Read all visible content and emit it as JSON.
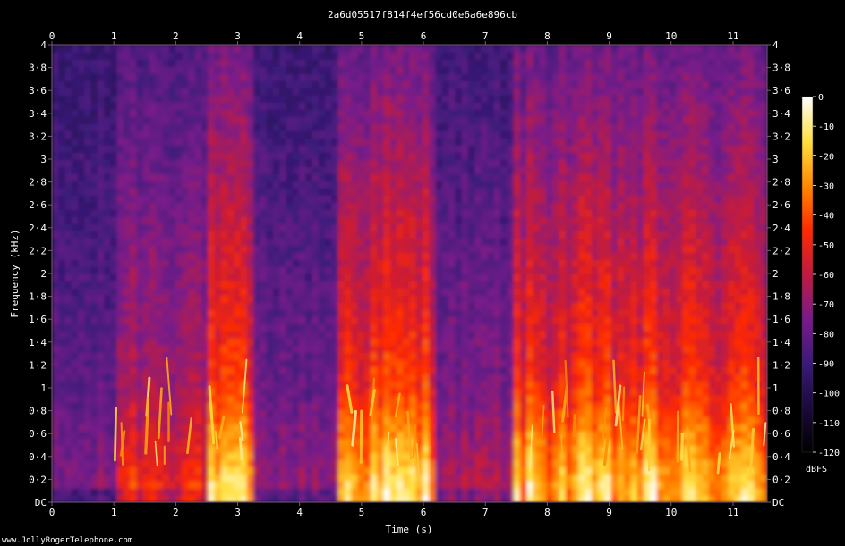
{
  "chart_data": {
    "type": "heatmap",
    "title": "2a6d05517f814f4ef56cd0e6a6e896cb",
    "xlabel": "Time (s)",
    "ylabel": "Frequency (kHz)",
    "xlim": [
      0,
      11.55
    ],
    "ylim": [
      0,
      4
    ],
    "x_ticks": [
      {
        "value": 0,
        "label": "0"
      },
      {
        "value": 1,
        "label": "1"
      },
      {
        "value": 2,
        "label": "2"
      },
      {
        "value": 3,
        "label": "3"
      },
      {
        "value": 4,
        "label": "4"
      },
      {
        "value": 5,
        "label": "5"
      },
      {
        "value": 6,
        "label": "6"
      },
      {
        "value": 7,
        "label": "7"
      },
      {
        "value": 8,
        "label": "8"
      },
      {
        "value": 9,
        "label": "9"
      },
      {
        "value": 10,
        "label": "10"
      },
      {
        "value": 11,
        "label": "11"
      }
    ],
    "y_ticks": [
      {
        "value": 0,
        "label": "DC"
      },
      {
        "value": 0.2,
        "label": "0·2"
      },
      {
        "value": 0.4,
        "label": "0·4"
      },
      {
        "value": 0.6,
        "label": "0·6"
      },
      {
        "value": 0.8,
        "label": "0·8"
      },
      {
        "value": 1.0,
        "label": "1"
      },
      {
        "value": 1.2,
        "label": "1·2"
      },
      {
        "value": 1.4,
        "label": "1·4"
      },
      {
        "value": 1.6,
        "label": "1·6"
      },
      {
        "value": 1.8,
        "label": "1·8"
      },
      {
        "value": 2.0,
        "label": "2"
      },
      {
        "value": 2.2,
        "label": "2·2"
      },
      {
        "value": 2.4,
        "label": "2·4"
      },
      {
        "value": 2.6,
        "label": "2·6"
      },
      {
        "value": 2.8,
        "label": "2·8"
      },
      {
        "value": 3.0,
        "label": "3"
      },
      {
        "value": 3.2,
        "label": "3·2"
      },
      {
        "value": 3.4,
        "label": "3·4"
      },
      {
        "value": 3.6,
        "label": "3·6"
      },
      {
        "value": 3.8,
        "label": "3·8"
      },
      {
        "value": 4.0,
        "label": "4"
      }
    ],
    "colorbar": {
      "label": "dBFS",
      "range": [
        -120,
        0
      ],
      "ticks": [
        {
          "value": 0,
          "label": "0"
        },
        {
          "value": -10,
          "label": "-10"
        },
        {
          "value": -20,
          "label": "-20"
        },
        {
          "value": -30,
          "label": "-30"
        },
        {
          "value": -40,
          "label": "-40"
        },
        {
          "value": -50,
          "label": "-50"
        },
        {
          "value": -60,
          "label": "-60"
        },
        {
          "value": -70,
          "label": "-70"
        },
        {
          "value": -80,
          "label": "-80"
        },
        {
          "value": -90,
          "label": "-90"
        },
        {
          "value": -100,
          "label": "-100"
        },
        {
          "value": -110,
          "label": "-110"
        },
        {
          "value": -120,
          "label": "-120"
        }
      ]
    },
    "colors": {
      "background": "#000000",
      "frame": "#7a5a80",
      "text": "#ffffff",
      "colormap": [
        "#000000",
        "#1a0a3a",
        "#3a1a7a",
        "#7a1a8a",
        "#c01a40",
        "#ff2a00",
        "#ff8a00",
        "#ffe040",
        "#ffffff"
      ]
    },
    "segments": [
      {
        "start": 0.0,
        "end": 1.0,
        "level": 0.25
      },
      {
        "start": 1.0,
        "end": 2.5,
        "level": 0.55
      },
      {
        "start": 2.5,
        "end": 3.3,
        "level": 0.8
      },
      {
        "start": 3.3,
        "end": 4.6,
        "level": 0.3
      },
      {
        "start": 4.6,
        "end": 6.2,
        "level": 0.85
      },
      {
        "start": 6.2,
        "end": 7.5,
        "level": 0.35
      },
      {
        "start": 7.5,
        "end": 11.55,
        "level": 0.8
      }
    ]
  },
  "footer": {
    "credit": "www.JollyRogerTelephone.com"
  }
}
